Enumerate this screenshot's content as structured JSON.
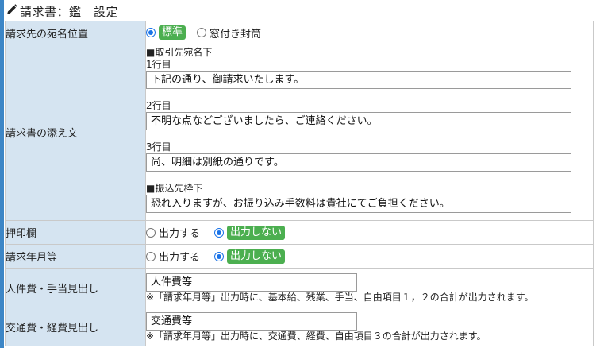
{
  "header": {
    "title": "請求書：鑑　設定",
    "icon": "pencil-icon"
  },
  "rows": {
    "address_position": {
      "label": "請求先の宛名位置",
      "options": [
        {
          "label": "標準",
          "selected": true
        },
        {
          "label": "窓付き封筒",
          "selected": false
        }
      ]
    },
    "attachment": {
      "label": "請求書の添え文",
      "section1": "■取引先宛名下",
      "line1_label": "1行目",
      "line1_value": "下記の通り、御請求いたします。",
      "line2_label": "2行目",
      "line2_value": "不明な点などございましたら、ご連絡ください。",
      "line3_label": "3行目",
      "line3_value": "尚、明細は別紙の通りです。",
      "section2": "■振込先枠下",
      "bank_value": "恐れ入りますが、お振り込み手数料は貴社にてご負担ください。"
    },
    "seal": {
      "label": "押印欄",
      "options": [
        {
          "label": "出力する",
          "selected": false
        },
        {
          "label": "出力しない",
          "selected": true
        }
      ]
    },
    "year_month": {
      "label": "請求年月等",
      "options": [
        {
          "label": "出力する",
          "selected": false
        },
        {
          "label": "出力しない",
          "selected": true
        }
      ]
    },
    "personnel": {
      "label": "人件費・手当見出し",
      "value": "人件費等",
      "note": "※「請求年月等」出力時に、基本給、残業、手当、自由項目１，２の合計が出力されます。"
    },
    "transport": {
      "label": "交通費・経費見出し",
      "value": "交通費等",
      "note": "※「請求年月等」出力時に、交通費、経費、自由項目３の合計が出力されます。"
    }
  }
}
